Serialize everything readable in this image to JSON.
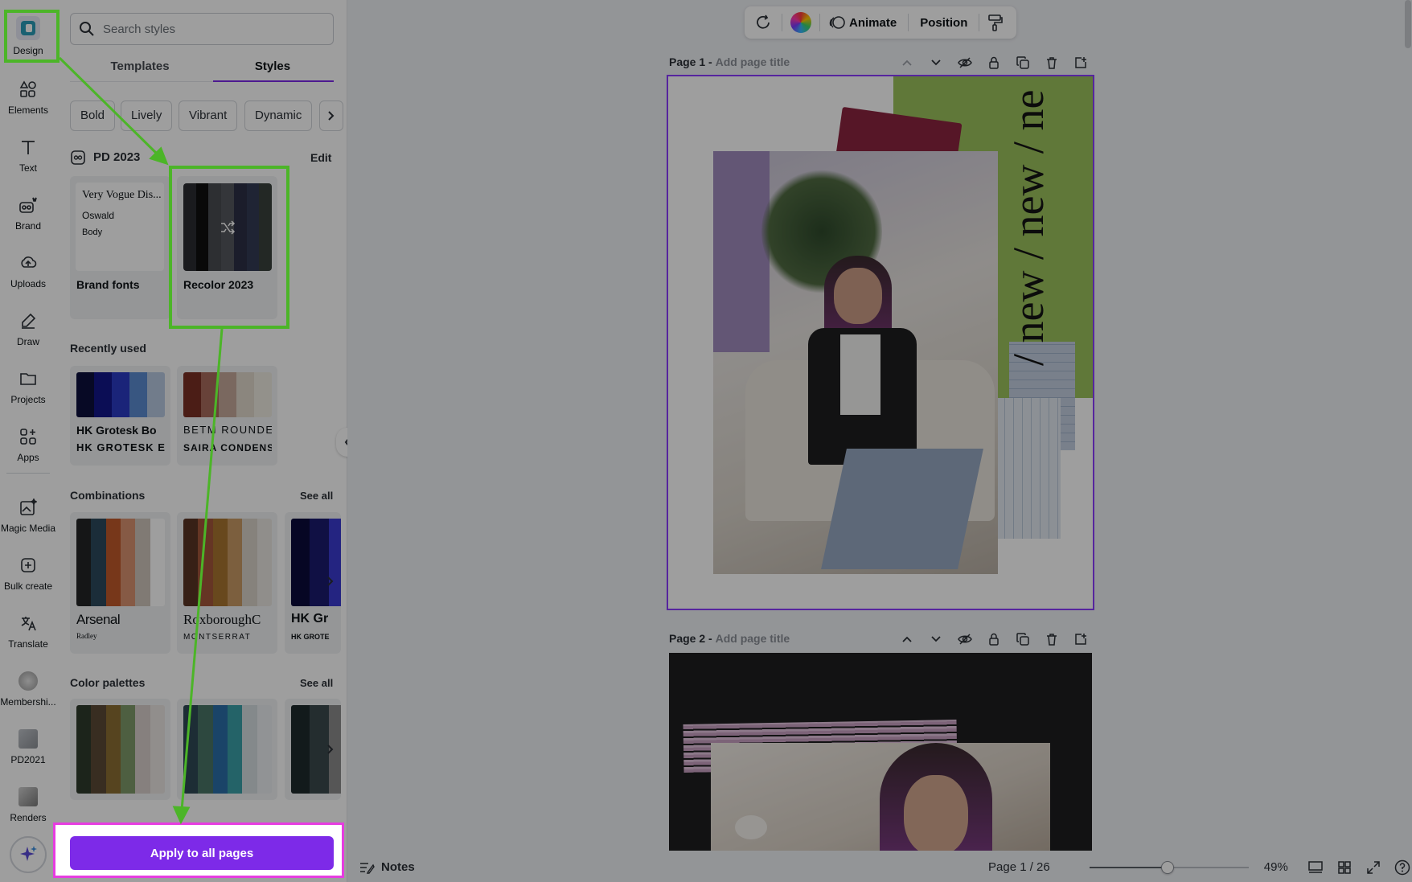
{
  "rail": {
    "items": [
      {
        "label": "Design",
        "icon": "design-icon"
      },
      {
        "label": "Elements",
        "icon": "elements-icon"
      },
      {
        "label": "Text",
        "icon": "text-icon"
      },
      {
        "label": "Brand",
        "icon": "brand-icon"
      },
      {
        "label": "Uploads",
        "icon": "uploads-icon"
      },
      {
        "label": "Draw",
        "icon": "draw-icon"
      },
      {
        "label": "Projects",
        "icon": "projects-icon"
      },
      {
        "label": "Apps",
        "icon": "apps-icon"
      },
      {
        "label": "Magic Media",
        "icon": "magic-media-icon"
      },
      {
        "label": "Bulk create",
        "icon": "bulk-create-icon"
      },
      {
        "label": "Translate",
        "icon": "translate-icon"
      },
      {
        "label": "Membershi...",
        "icon": "membership-app-icon"
      },
      {
        "label": "PD2021",
        "icon": "pd2021-app-icon"
      },
      {
        "label": "Renders",
        "icon": "renders-app-icon"
      }
    ]
  },
  "panel": {
    "search_placeholder": "Search styles",
    "tabs": [
      "Templates",
      "Styles"
    ],
    "active_tab": "Styles",
    "chips": [
      "Bold",
      "Lively",
      "Vibrant",
      "Dynamic"
    ],
    "brand_kit": {
      "name": "PD 2023",
      "edit_label": "Edit"
    },
    "brand_fonts": {
      "label": "Brand fonts",
      "font_lines": [
        "Very Vogue Dis...",
        "Oswald",
        "Body"
      ]
    },
    "recolor": {
      "label": "Recolor 2023",
      "colors": [
        "#2b2d31",
        "#0f0f10",
        "#4a4d52",
        "#55585e",
        "#2c3046",
        "#333a55",
        "#39423c"
      ]
    },
    "recently_used": {
      "title": "Recently used",
      "cards": [
        {
          "line1": "HK Grotesk Bo",
          "line2": "HK GROTESK E",
          "colors": [
            "#0c0f3d",
            "#13158a",
            "#2a3ac4",
            "#5b8bd0",
            "#b7c9e0"
          ]
        },
        {
          "line1": "BETM ROUNDE",
          "line2": "SAIRA CONDENSED",
          "colors": [
            "#7a2f24",
            "#a86b5d",
            "#c5a89a",
            "#e0d8cc",
            "#eeeae0"
          ]
        }
      ]
    },
    "combinations": {
      "title": "Combinations",
      "see_all": "See all",
      "cards": [
        {
          "line1": "Arsenal",
          "line2": "Radley",
          "colors": [
            "#222426",
            "#2c4a5c",
            "#c05a2a",
            "#d89270",
            "#cfc6bc",
            "#ffffff"
          ]
        },
        {
          "line1": "RoxboroughC",
          "line2": "MONTSERRAT",
          "colors": [
            "#5a3524",
            "#a3563a",
            "#a8742f",
            "#c99a64",
            "#d9d2c8",
            "#e9e6e0"
          ]
        },
        {
          "line1": "HK Gr",
          "line2": "HK GROTE",
          "colors": [
            "#0a0a3a",
            "#1a1a6e",
            "#3a3ad0"
          ]
        }
      ]
    },
    "color_palettes": {
      "title": "Color palettes",
      "see_all": "See all",
      "cards": [
        {
          "colors": [
            "#2e3a2c",
            "#5b4a36",
            "#8c6f32",
            "#7f9a6a",
            "#d9cfcc",
            "#eae6e3"
          ]
        },
        {
          "colors": [
            "#2f4a56",
            "#4a7466",
            "#2a6fa8",
            "#3aa0a8",
            "#d6dde0",
            "#ebeef0"
          ]
        },
        {
          "colors": [
            "#1e2a2c",
            "#3a4a4c",
            "#8c8c8c"
          ]
        }
      ]
    },
    "apply_label": "Apply to all pages"
  },
  "toolbar": {
    "animate_label": "Animate",
    "position_label": "Position"
  },
  "pages": [
    {
      "number_label": "Page 1 -",
      "title_placeholder": "Add page title"
    },
    {
      "number_label": "Page 2 -",
      "title_placeholder": "Add page title"
    }
  ],
  "page1_art": {
    "vertical_text": "/ new / new / ne"
  },
  "footer": {
    "notes_label": "Notes",
    "page_indicator": "Page 1 / 26",
    "zoom": "49%",
    "zoom_fraction": 0.49
  },
  "colors": {
    "accent": "#7d2ae8",
    "highlight_green": "#4cb528",
    "highlight_magenta": "#e63ce0",
    "lime": "#9bc25c"
  }
}
